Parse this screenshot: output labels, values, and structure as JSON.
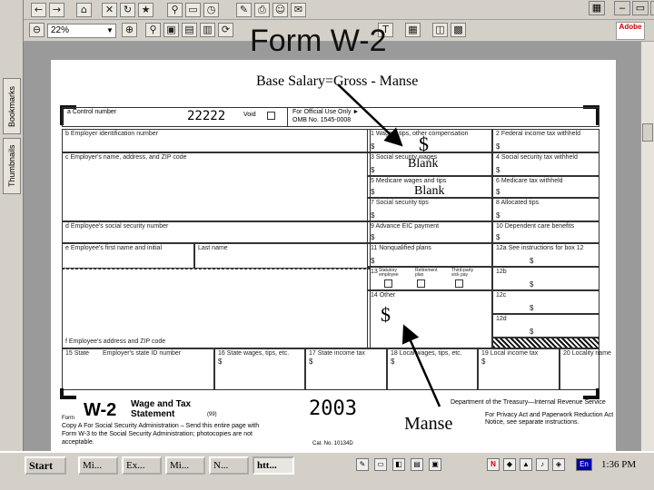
{
  "viewer": {
    "zoom": "22%",
    "tabs": {
      "bookmarks": "Bookmarks",
      "thumbnails": "Thumbnails"
    },
    "adobe_label": "Adobe"
  },
  "overlay": {
    "title": "Form W-2",
    "subtitle": "Base Salary=Gross - Manse",
    "dollar_wages": "$",
    "blank1": "Blank",
    "blank2": "Blank",
    "dollar_other": "$",
    "manse": "Manse"
  },
  "form": {
    "box_a_label": "a Control number",
    "control_number": "22222",
    "void_label": "Void",
    "official_use": "For Official Use Only ►",
    "omb": "OMB No. 1545-0008",
    "box_b": "b Employer identification number",
    "box_c": "c Employer's name, address, and ZIP code",
    "box_d": "d Employee's social security number",
    "box_e": "e Employee's first name and initial",
    "last_name": "Last name",
    "box_f": "f Employee's address and ZIP code",
    "box1": "1 Wages, tips, other compensation",
    "box2": "2 Federal income tax withheld",
    "box3": "3 Social security wages",
    "box4": "4 Social security tax withheld",
    "box5": "5 Medicare wages and tips",
    "box6": "6 Medicare tax withheld",
    "box7": "7 Social security tips",
    "box8": "8 Allocated tips",
    "box9": "9 Advance EIC payment",
    "box10": "10 Dependent care benefits",
    "box11": "11 Nonqualified plans",
    "box12a": "12a See instructions for box 12",
    "box12b": "12b",
    "box12c": "12c",
    "box12d": "12d",
    "box13": "13",
    "box13_a": "Statutory employee",
    "box13_b": "Retirement plan",
    "box13_c": "Third-party sick pay",
    "box14": "14 Other",
    "box15": "15 State",
    "box15b": "Employer's state ID number",
    "box16": "16 State wages, tips, etc.",
    "box17": "17 State income tax",
    "box18": "18 Local wages, tips, etc.",
    "box19": "19 Local income tax",
    "box20": "20 Locality name",
    "dollar": "$",
    "form_code": "W-2",
    "form_name_1": "Wage and Tax",
    "form_name_2": "Statement",
    "form_prefix": "Form",
    "rev": "(99)",
    "year": "2003",
    "copy_a": "Copy A For Social Security Administration – Send this entire page with Form W-3 to the Social Security Administration; photocopies are not acceptable.",
    "dept": "Department of the Treasury—Internal Revenue Service",
    "privacy": "For Privacy Act and Paperwork Reduction Act Notice, see separate instructions.",
    "cat": "Cat. No. 10134D"
  },
  "taskbar": {
    "start": "Start",
    "tasks": [
      "Mi...",
      "Ex...",
      "Mi...",
      "N...",
      "htt..."
    ],
    "lang": "En",
    "clock": "1:36 PM"
  }
}
